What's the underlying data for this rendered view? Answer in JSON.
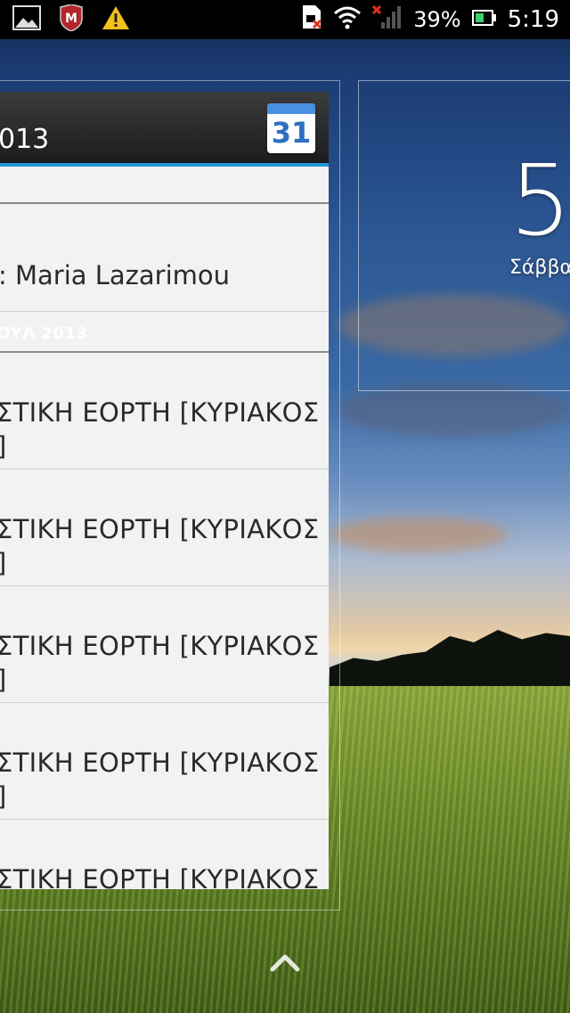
{
  "status_bar": {
    "icons_left": [
      "image-icon",
      "mcafee-icon",
      "warning-icon"
    ],
    "icons_right": [
      "sim-error-icon",
      "wifi-icon",
      "signal-icon",
      "battery-icon"
    ],
    "battery": "39%",
    "time": "5:19"
  },
  "calendar_widget": {
    "title": "013",
    "icon_number": "31",
    "top_event": ": Maria Lazarimou",
    "day_header": "ΟΥΛ 2013",
    "events": [
      {
        "line1": "ΣΤΙΚΗ ΕΟΡΤΗ [ΚΥΡΙΑΚΟΣ",
        "line2": "]"
      },
      {
        "line1": "ΣΤΙΚΗ ΕΟΡΤΗ [ΚΥΡΙΑΚΟΣ",
        "line2": "]"
      },
      {
        "line1": "ΣΤΙΚΗ ΕΟΡΤΗ [ΚΥΡΙΑΚΟΣ",
        "line2": "]"
      },
      {
        "line1": "ΣΤΙΚΗ ΕΟΡΤΗ [ΚΥΡΙΑΚΟΣ",
        "line2": "]"
      },
      {
        "line1": "ΣΤΙΚΗ ΕΟΡΤΗ [ΚΥΡΙΑΚΟΣ",
        "line2": ""
      }
    ]
  },
  "clock_widget": {
    "time": "5",
    "day": "Σάββα"
  },
  "colors": {
    "accent": "#2196d3",
    "warning": "#f2c21b",
    "calendar_blue": "#2e6fc2"
  }
}
